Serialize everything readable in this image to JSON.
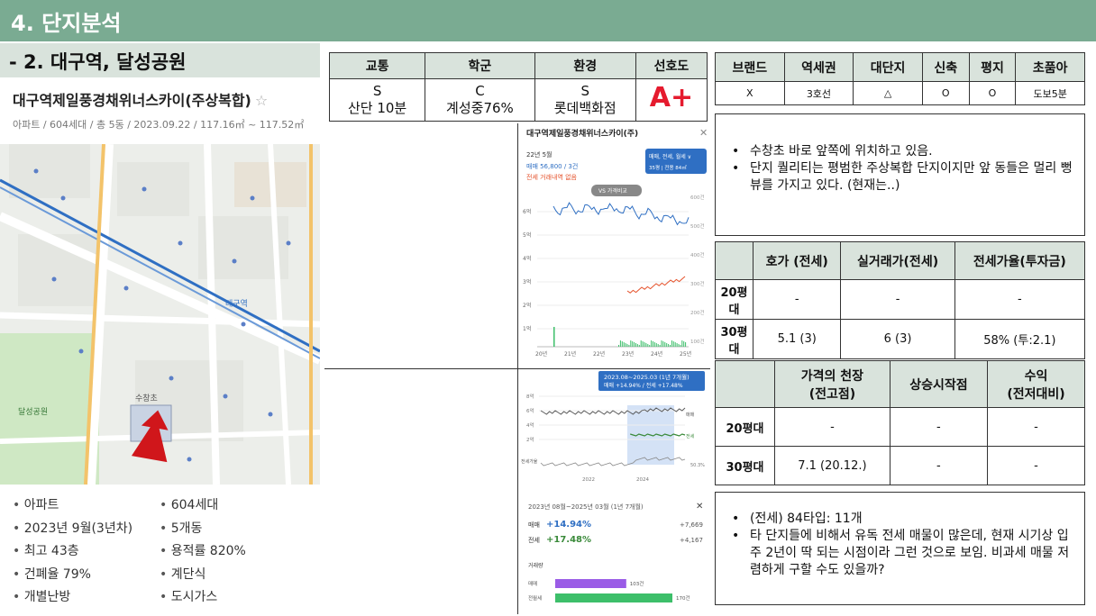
{
  "header": {
    "title": "4. 단지분석",
    "subtitle": "- 2. 대구역, 달성공원"
  },
  "apartment": {
    "name": "대구역제일풍경채위너스카이(주상복합)",
    "star": "☆",
    "meta": "아파트 / 604세대 / 총 5동 / 2023.09.22 / 117.16㎡ ~ 117.52㎡"
  },
  "facts_left": [
    "아파트",
    "2023년 9월(3년차)",
    "최고 43층",
    "건폐율 79%",
    "개별난방"
  ],
  "facts_right": [
    "604세대",
    "5개동",
    "용적률 820%",
    "계단식",
    "도시가스"
  ],
  "grades": {
    "headers": [
      "교통",
      "학군",
      "환경",
      "선호도"
    ],
    "cells": [
      {
        "line1": "S",
        "line2": "산단 10분"
      },
      {
        "line1": "C",
        "line2": "계성중76%"
      },
      {
        "line1": "S",
        "line2": "롯데백화점"
      }
    ],
    "preference": "A+",
    "preference_color": "#e51b2e"
  },
  "brand": {
    "headers": [
      "브랜드",
      "역세권",
      "대단지",
      "신축",
      "평지",
      "초품아"
    ],
    "values": [
      "X",
      "3호선",
      "△",
      "O",
      "O",
      "도보5분"
    ]
  },
  "note1": [
    "수창초 바로 앞쪽에 위치하고 있음.",
    "단지 퀄리티는 평범한 주상복합 단지이지만 앞 동들은 멀리 뻥뷰를 가지고 있다. (현재는..)"
  ],
  "price_table1": {
    "headers": [
      "",
      "호가 (전세)",
      "실거래가(전세)",
      "전세가율(투자금)"
    ],
    "rows": [
      {
        "label": "20평대",
        "c1": "-",
        "c2": "-",
        "c3": "-"
      },
      {
        "label": "30평대",
        "c1": "5.1 (3)",
        "c2": "6 (3)",
        "c3": "58% (투:2.1)"
      }
    ]
  },
  "price_table2": {
    "headers": [
      "",
      "가격의 천장\n(전고점)",
      "상승시작점",
      "수익\n(전저대비)"
    ],
    "rows": [
      {
        "label": "20평대",
        "c1": "-",
        "c2": "-",
        "c3": "-"
      },
      {
        "label": "30평대",
        "c1": "7.1 (20.12.)",
        "c2": "-",
        "c3": "-"
      }
    ]
  },
  "note2": [
    "(전세) 84타입: 11개",
    "타 단지들에 비해서 유독 전세 매물이 많은데, 현재 시기상 입주 2년이 딱 되는 시점이라 그런 것으로 보임. 비과세 매물 저렴하게 구할 수도 있을까?"
  ],
  "chart1": {
    "title": "대구역제일풍경채위너스카이(주)",
    "date": "22년 5월",
    "sale": "매매 56,800 / 3건",
    "jeonse": "전세 거래내역 없음",
    "badge": "매매, 전세, 월세 ∨",
    "badge2": "35평 | 전용 84㎡",
    "vs": "VS 가격비교",
    "x_ticks": [
      "20년",
      "21년",
      "22년",
      "23년",
      "24년",
      "25년"
    ],
    "y_ticks": [
      "6억",
      "5억",
      "4억",
      "3억",
      "2억",
      "1억"
    ],
    "y2_ticks": [
      "600건",
      "500건",
      "400건",
      "300건",
      "200건",
      "100건"
    ]
  },
  "chart2": {
    "period_label": "2023.08~2025.03 (1년 7개월)",
    "change": "매매 +14.94% / 전세 +17.48%",
    "x_ticks": [
      "2022",
      "2024"
    ],
    "y_ticks": [
      "8억",
      "6억",
      "4억",
      "2억"
    ],
    "side_labels": [
      "매매",
      "전세"
    ],
    "ratio_label": "전세가율",
    "ratio_value": "50.3%"
  },
  "chart3": {
    "period": "2023년 08월~2025년 03월 (1년 7개월)",
    "close": "✕",
    "sale_label": "매매",
    "sale_change": "+14.94%",
    "sale_amount": "+7,669",
    "jeonse_label": "전세",
    "jeonse_change": "+17.48%",
    "jeonse_amount": "+4,167",
    "volume_title": "거래량",
    "volume": [
      {
        "label": "매매",
        "value": "103건",
        "count": 103,
        "color": "#9a5ce6"
      },
      {
        "label": "전월세",
        "value": "170건",
        "count": 170,
        "color": "#3dbf6a"
      }
    ]
  },
  "map_labels": [
    "달성공원",
    "대구역",
    "수창초"
  ]
}
